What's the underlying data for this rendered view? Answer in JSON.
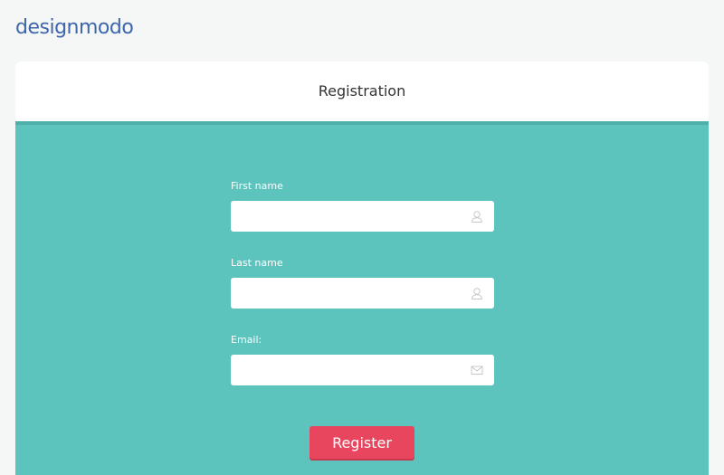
{
  "brand": {
    "logo_text": "designmodo",
    "logo_color": "#3d66ad"
  },
  "form": {
    "title": "Registration",
    "fields": [
      {
        "label": "First name",
        "value": "",
        "placeholder": "",
        "icon": "user-icon"
      },
      {
        "label": "Last name",
        "value": "",
        "placeholder": "",
        "icon": "user-icon"
      },
      {
        "label": "Email:",
        "value": "",
        "placeholder": "",
        "icon": "envelope-icon"
      }
    ],
    "submit_label": "Register"
  },
  "colors": {
    "background": "#f5f6f6",
    "panel": "#5cc3bd",
    "header_border": "#4fb0aa",
    "button": "#e8465f"
  }
}
